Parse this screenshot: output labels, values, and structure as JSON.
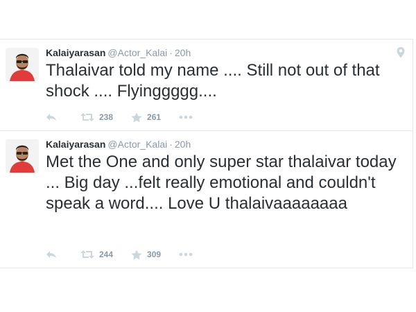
{
  "tweets": [
    {
      "name": "Kalaiyarasan",
      "handle": "@Actor_Kalai",
      "separator": "·",
      "time": "20h",
      "text": "Thalaivar told my name .... Still not out of that shock .... Flyinggggg....",
      "retweets": "238",
      "favorites": "261",
      "has_location_icon": true
    },
    {
      "name": "Kalaiyarasan",
      "handle": "@Actor_Kalai",
      "separator": "·",
      "time": "20h",
      "text": "Met the One and only super star thalaivar today ... Big day ...felt really emotional and couldn't speak a word.... Love U thalaivaaaaaaaa",
      "retweets": "244",
      "favorites": "309",
      "has_location_icon": false
    }
  ],
  "colors": {
    "text": "#292f33",
    "muted": "#8899a6",
    "border": "#e1e8ed"
  },
  "icons": [
    "reply-icon",
    "retweet-icon",
    "favorite-icon",
    "more-icon",
    "location-pin-icon"
  ]
}
